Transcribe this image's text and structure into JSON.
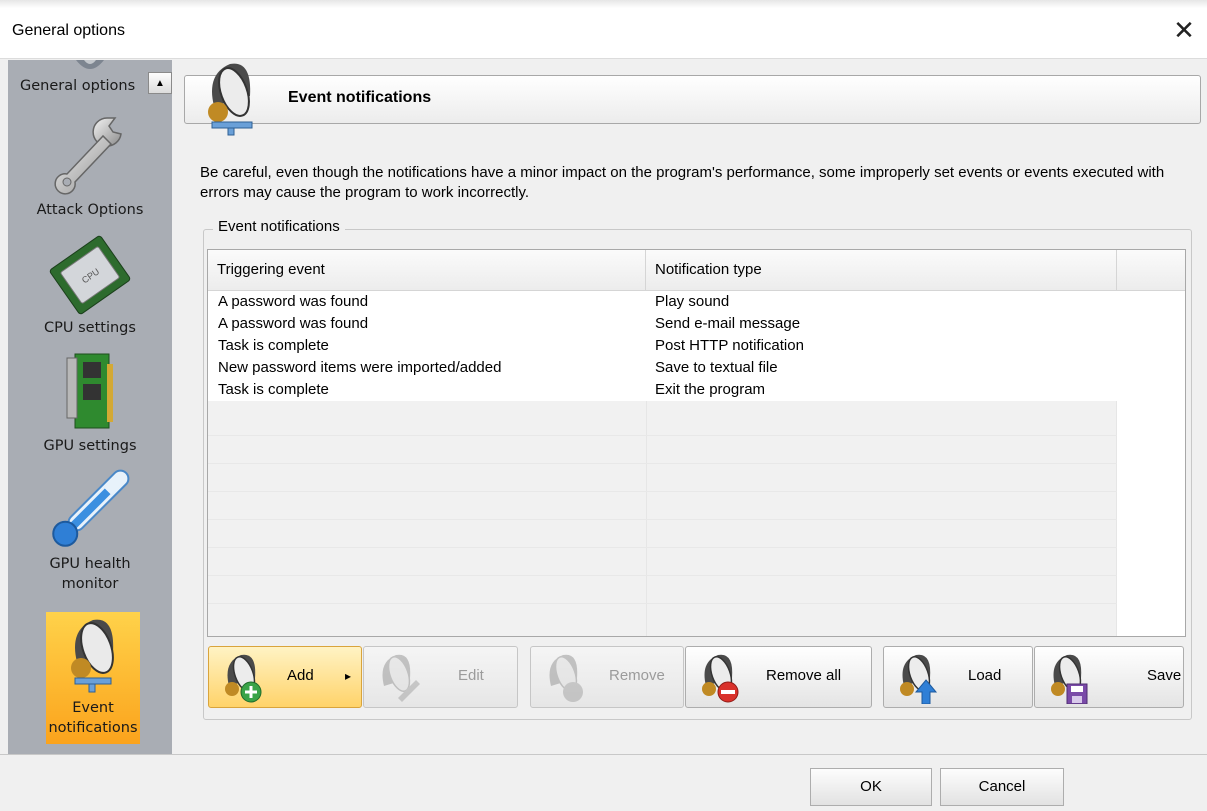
{
  "window": {
    "title": "General options",
    "close_glyph": "✕"
  },
  "sidebar": {
    "scroll_up_glyph": "▲",
    "items": [
      {
        "label": "General options",
        "icon": "gear-icon"
      },
      {
        "label": "Attack Options",
        "icon": "wrench-icon"
      },
      {
        "label": "CPU settings",
        "icon": "cpu-icon"
      },
      {
        "label": "GPU settings",
        "icon": "gpu-card-icon"
      },
      {
        "label_line1": "GPU health",
        "label_line2": "monitor",
        "icon": "thermometer-icon"
      },
      {
        "label_line1": "Event",
        "label_line2": "notifications",
        "icon": "speaker-icon",
        "active": true
      }
    ]
  },
  "header": {
    "title": "Event notifications",
    "icon": "speaker-icon"
  },
  "warning_text": "Be careful, even though the notifications have a minor impact on the program's performance, some improperly set events or events executed with errors may cause the program to work incorrectly.",
  "group": {
    "label": "Event notifications"
  },
  "table": {
    "columns": [
      "Triggering event",
      "Notification type"
    ],
    "rows": [
      [
        "A password was found",
        "Play sound"
      ],
      [
        "A password was found",
        "Send e-mail message"
      ],
      [
        "Task is complete",
        "Post HTTP notification"
      ],
      [
        "New password items were imported/added",
        "Save to textual file"
      ],
      [
        "Task is complete",
        "Exit the program"
      ]
    ]
  },
  "buttons": {
    "add": "Add",
    "add_arrow": "▸",
    "edit": "Edit",
    "remove": "Remove",
    "remove_all": "Remove all",
    "load": "Load",
    "save": "Save"
  },
  "dialog": {
    "ok": "OK",
    "cancel": "Cancel"
  },
  "colors": {
    "sidebar_bg": "#a9adb4",
    "active_item": "#fbb42c",
    "add_button": "#ffd36a"
  }
}
